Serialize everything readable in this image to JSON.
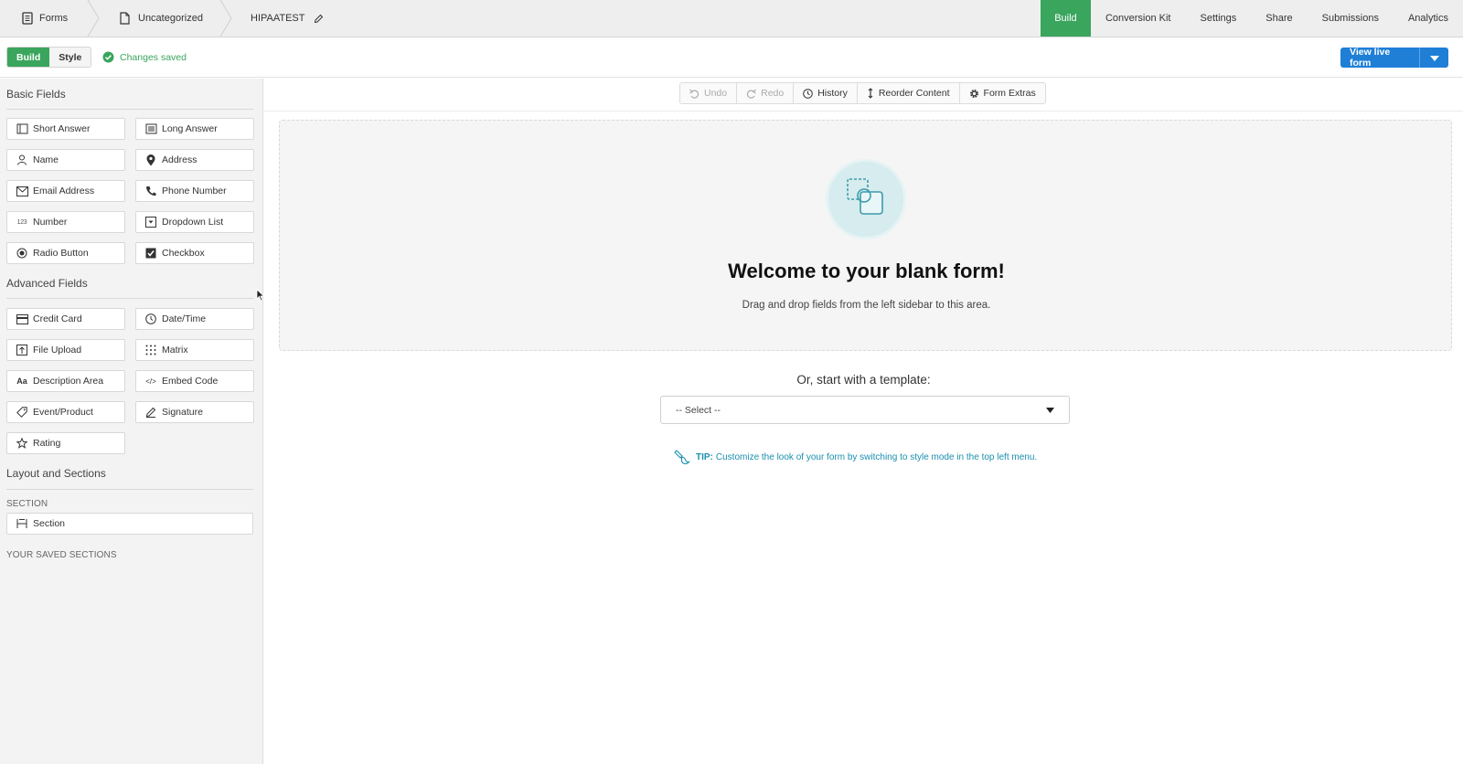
{
  "topnav": {
    "breadcrumbs": [
      {
        "label": "Forms",
        "icon": "form-icon"
      },
      {
        "label": "Uncategorized",
        "icon": "folder-icon"
      },
      {
        "label": "HIPAATEST",
        "icon": "pencil-icon"
      }
    ],
    "tabs": [
      {
        "label": "Build",
        "active": true
      },
      {
        "label": "Conversion Kit"
      },
      {
        "label": "Settings"
      },
      {
        "label": "Share"
      },
      {
        "label": "Submissions"
      },
      {
        "label": "Analytics"
      }
    ]
  },
  "subbar": {
    "modes": [
      "Build",
      "Style"
    ],
    "active_mode": "Build",
    "saved_status": "Changes saved",
    "view_live_label": "View live form"
  },
  "sidebar": {
    "basic_title": "Basic Fields",
    "basic_fields": [
      {
        "label": "Short Answer",
        "icon": "short-answer-icon"
      },
      {
        "label": "Long Answer",
        "icon": "long-answer-icon"
      },
      {
        "label": "Name",
        "icon": "person-icon"
      },
      {
        "label": "Address",
        "icon": "map-pin-icon"
      },
      {
        "label": "Email Address",
        "icon": "envelope-icon"
      },
      {
        "label": "Phone Number",
        "icon": "phone-icon"
      },
      {
        "label": "Number",
        "icon": "number-icon"
      },
      {
        "label": "Dropdown List",
        "icon": "dropdown-icon"
      },
      {
        "label": "Radio Button",
        "icon": "radio-icon"
      },
      {
        "label": "Checkbox",
        "icon": "checkbox-icon"
      }
    ],
    "advanced_title": "Advanced Fields",
    "advanced_fields": [
      {
        "label": "Credit Card",
        "icon": "credit-card-icon"
      },
      {
        "label": "Date/Time",
        "icon": "clock-icon"
      },
      {
        "label": "File Upload",
        "icon": "upload-icon"
      },
      {
        "label": "Matrix",
        "icon": "matrix-icon"
      },
      {
        "label": "Description Area",
        "icon": "text-icon"
      },
      {
        "label": "Embed Code",
        "icon": "code-icon"
      },
      {
        "label": "Event/Product",
        "icon": "tag-icon"
      },
      {
        "label": "Signature",
        "icon": "pen-icon"
      },
      {
        "label": "Rating",
        "icon": "star-icon"
      }
    ],
    "layout_title": "Layout and Sections",
    "section_caption": "SECTION",
    "section_item": "Section",
    "saved_sections_caption": "YOUR SAVED SECTIONS"
  },
  "canvas": {
    "toolbar": [
      {
        "label": "Undo",
        "icon": "undo-icon",
        "disabled": true
      },
      {
        "label": "Redo",
        "icon": "redo-icon",
        "disabled": true
      },
      {
        "label": "History",
        "icon": "history-icon"
      },
      {
        "label": "Reorder Content",
        "icon": "reorder-icon"
      },
      {
        "label": "Form Extras",
        "icon": "gear-icon"
      }
    ],
    "welcome_title": "Welcome to your blank form!",
    "welcome_sub": "Drag and drop fields from the left sidebar to this area.",
    "template_label": "Or, start with a template:",
    "template_select": "-- Select --",
    "tip_prefix": "TIP:",
    "tip_text": "Customize the look of your form by switching to style mode in the top left menu."
  },
  "colors": {
    "accent_green": "#3aa55d",
    "accent_blue": "#1f7fd6",
    "tip_teal": "#1a8fae"
  }
}
